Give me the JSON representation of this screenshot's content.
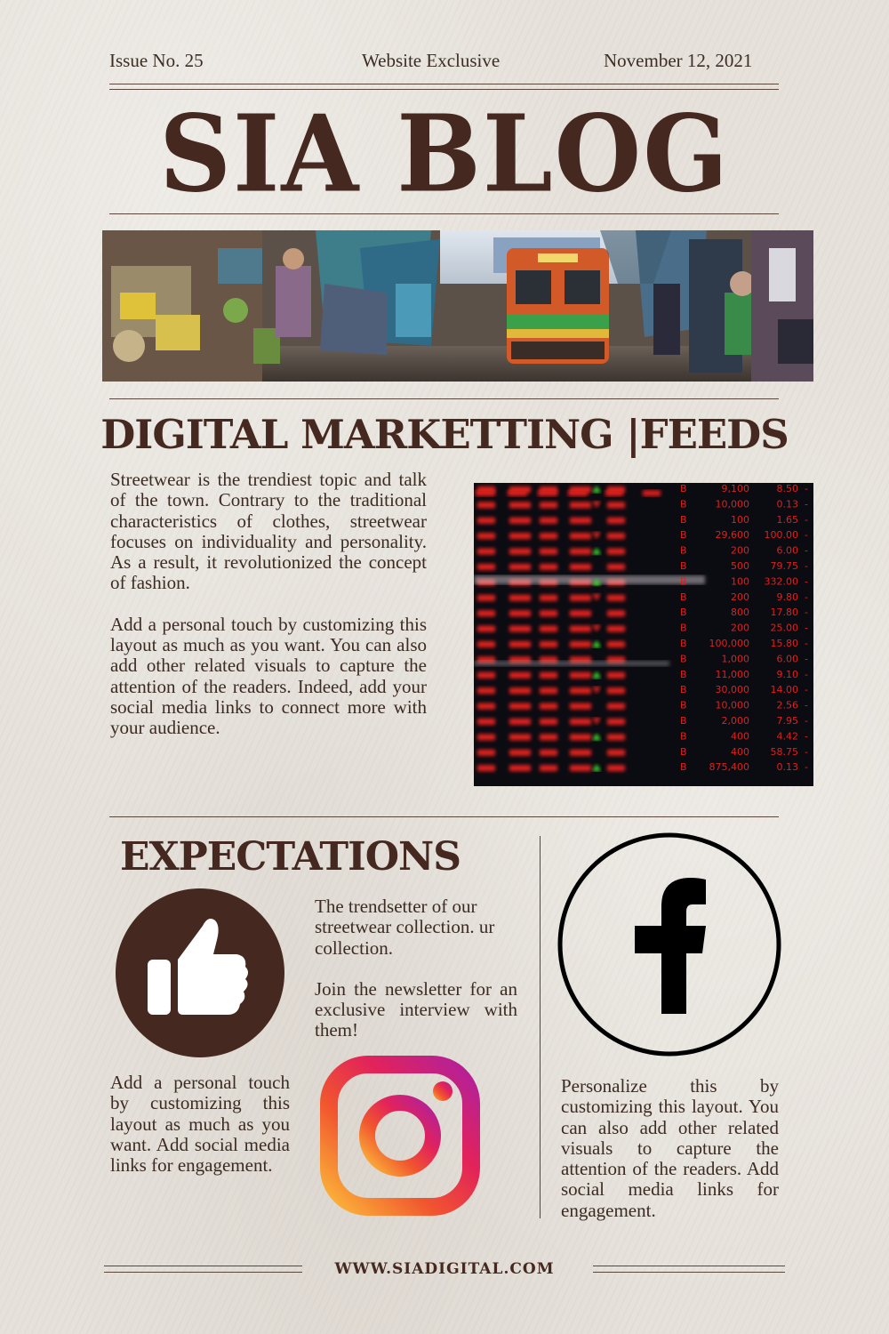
{
  "header": {
    "issue": "Issue No. 25",
    "edition": "Website Exclusive",
    "date": "November 12, 2021",
    "masthead": "SIA BLOG"
  },
  "feature": {
    "heading": "DIGITAL MARKETTING  |FEEDS",
    "paragraphs": [
      "Streetwear is the trendiest topic and talk of the town. Contrary to the traditional characteristics of clothes, streetwear focuses on individuality and personality. As a result, it revolutionized the concept of fashion.",
      "Add a personal touch by customizing this layout as much as you want. You can also add other related visuals to capture the attention of the readers. Indeed, add your social media links to connect more with your audience."
    ],
    "ticker_rows": [
      {
        "qty": "9,100",
        "price": "8.50"
      },
      {
        "qty": "10,000",
        "price": "0.13"
      },
      {
        "qty": "100",
        "price": "1.65"
      },
      {
        "qty": "29,600",
        "price": "100.00"
      },
      {
        "qty": "200",
        "price": "6.00"
      },
      {
        "qty": "500",
        "price": "79.75"
      },
      {
        "qty": "100",
        "price": "332.00"
      },
      {
        "qty": "200",
        "price": "9.80"
      },
      {
        "qty": "800",
        "price": "17.80"
      },
      {
        "qty": "200",
        "price": "25.00"
      },
      {
        "qty": "100,000",
        "price": "15.80"
      },
      {
        "qty": "1,000",
        "price": "6.00"
      },
      {
        "qty": "11,000",
        "price": "9.10"
      },
      {
        "qty": "30,000",
        "price": "14.00"
      },
      {
        "qty": "10,000",
        "price": "2.56"
      },
      {
        "qty": "2,000",
        "price": "7.95"
      },
      {
        "qty": "400",
        "price": "4.42"
      },
      {
        "qty": "400",
        "price": "58.75"
      },
      {
        "qty": "875,400",
        "price": "0.13"
      }
    ]
  },
  "expectations": {
    "heading": "EXPECTATIONS",
    "middle_paragraphs": [
      "The trendsetter of our streetwear collection. ur collection.",
      "Join the newsletter for an exclusive interview with them!"
    ],
    "left_paragraph": "Add a personal touch by customizing this layout as much as you want. Add social media links for engagement.",
    "right_paragraph": "Personalize this by customizing this layout. You can also add other related visuals to capture the attention of the readers. Add social media links for engagement."
  },
  "icons": {
    "like": "thumbs-up-icon",
    "instagram": "instagram-icon",
    "facebook": "facebook-icon"
  },
  "colors": {
    "brown": "#45281f",
    "paper": "#e6e1da",
    "ticker_red": "#e0201e",
    "ticker_green": "#3cdc2a"
  },
  "footer": {
    "url": "WWW.SIADIGITAL.COM"
  }
}
